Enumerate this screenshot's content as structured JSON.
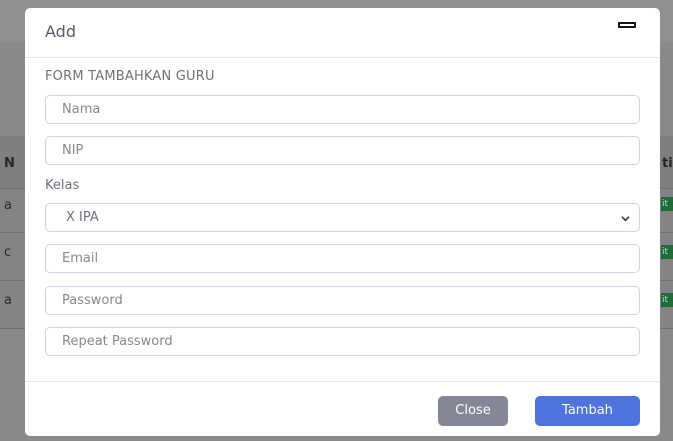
{
  "modal": {
    "title": "Add",
    "form_heading": "FORM TAMBAHKAN GURU",
    "fields": {
      "nama_placeholder": "Nama",
      "nip_placeholder": "NIP",
      "kelas_label": "Kelas",
      "kelas_selected": "X IPA",
      "email_placeholder": "Email",
      "password_placeholder": "Password",
      "repeat_password_placeholder": "Repeat Password"
    },
    "footer": {
      "close_label": "Close",
      "submit_label": "Tambah"
    }
  },
  "background": {
    "left_fragments": [
      "N",
      "a",
      "c",
      "a"
    ],
    "right_fragments": [
      "ti"
    ],
    "badge_fragment": "it"
  },
  "colors": {
    "primary": "#4e73df",
    "secondary": "#858796",
    "badge_green": "#1f6b3a"
  }
}
